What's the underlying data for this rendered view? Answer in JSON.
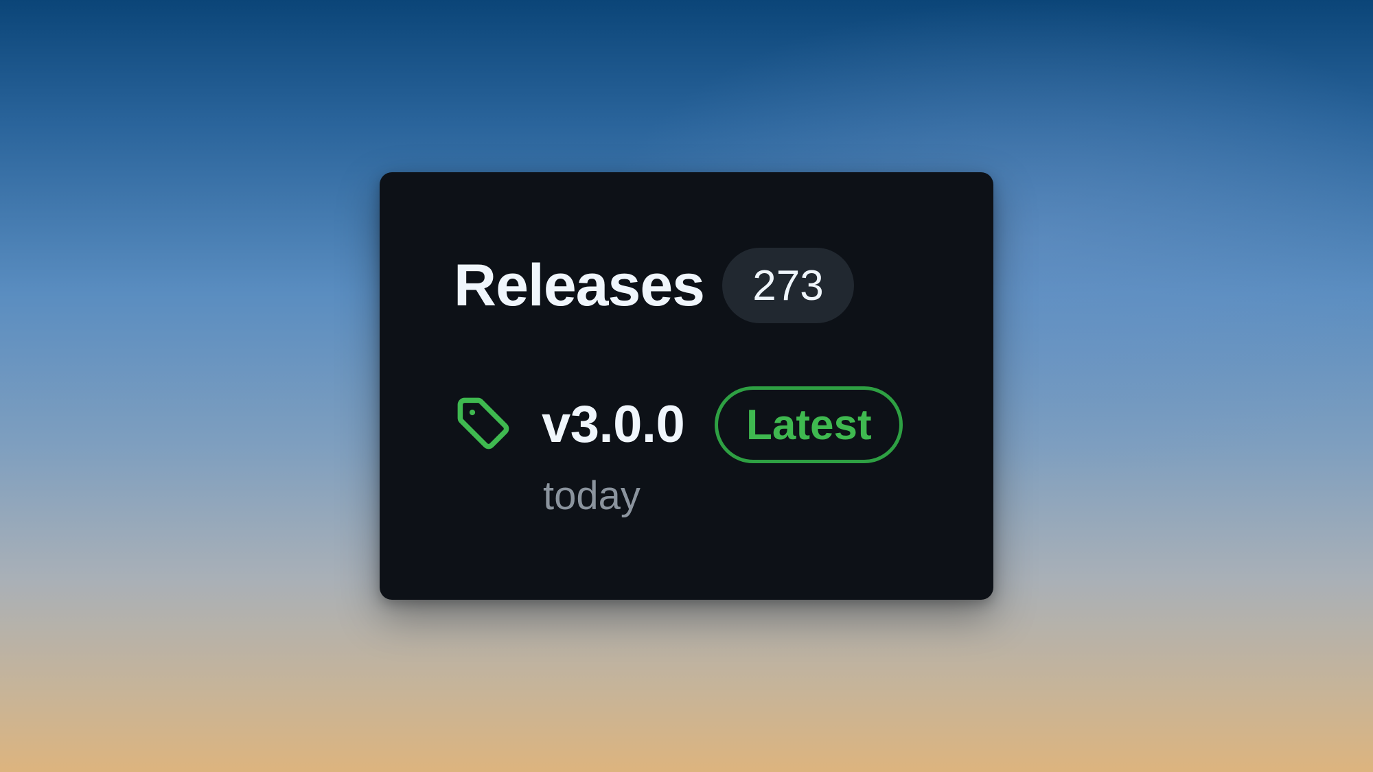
{
  "releases": {
    "title": "Releases",
    "count": "273",
    "latest": {
      "icon": "tag-icon",
      "version": "v3.0.0",
      "badge": "Latest",
      "date": "today"
    }
  },
  "colors": {
    "card_background": "#0d1117",
    "count_background": "#212830",
    "text_primary": "#f0f6fc",
    "text_muted": "#8b949e",
    "accent_green": "#3fb950",
    "badge_border_green": "#2ea043"
  }
}
